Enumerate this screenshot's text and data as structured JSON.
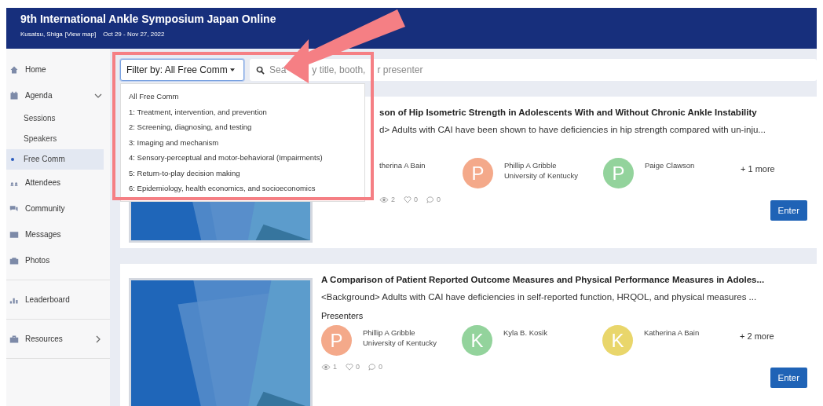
{
  "header": {
    "title": "9th International Ankle Symposium Japan Online",
    "location": "Kusatsu, Shiga",
    "map_link": "[View map]",
    "dates": "Oct 29 - Nov 27, 2022"
  },
  "sidebar": {
    "items": [
      {
        "label": "Home",
        "selected": false
      },
      {
        "label": "Agenda",
        "selected": false,
        "expanded": true,
        "children": [
          {
            "label": "Sessions",
            "selected": false
          },
          {
            "label": "Speakers",
            "selected": false
          },
          {
            "label": "Free Comm",
            "selected": true
          }
        ]
      },
      {
        "label": "Attendees",
        "selected": false
      },
      {
        "label": "Community",
        "selected": false
      },
      {
        "label": "Messages",
        "selected": false
      },
      {
        "label": "Photos",
        "selected": false
      },
      {
        "label": "Leaderboard",
        "selected": false
      },
      {
        "label": "Resources",
        "selected": false,
        "expanded": false
      }
    ]
  },
  "filter": {
    "label": "Filter by: All Free Comm",
    "open": true,
    "options": [
      "All Free Comm",
      "1: Treatment, intervention, and prevention",
      "2: Screening, diagnosing, and testing",
      "3: Imaging and mechanism",
      "4: Sensory-perceptual and motor-behavioral (Impairments)",
      "5: Return-to-play decision making",
      "6: Epidemiology, health economics, and socioeconomics"
    ]
  },
  "search": {
    "placeholder_parts": [
      "Sea",
      "y title, booth,",
      "r presenter"
    ]
  },
  "cards": [
    {
      "title": "son of Hip Isometric Strength in Adolescents With and Without Chronic Ankle Instability",
      "summary": "d> Adults with CAI have been shown to have deficiencies in hip strength compared with un-inju...",
      "presenters": [
        {
          "name": "therina A Bain"
        },
        {
          "initial": "P",
          "name": "Phillip A Gribble",
          "affiliation": "University of Kentucky",
          "color": "#f4a98a"
        },
        {
          "initial": "P",
          "name": "Paige Clawson",
          "color": "#93d39c"
        }
      ],
      "more": "+ 1 more",
      "views": "2",
      "likes": "0",
      "comments": "0",
      "button": "Enter"
    },
    {
      "title": "A Comparison of Patient Reported Outcome Measures and Physical Performance Measures in Adoles...",
      "summary": "<Background> Adults with CAI have deficiencies in self-reported function, HRQOL, and physical measures ...",
      "presenters_label": "Presenters",
      "presenters": [
        {
          "initial": "P",
          "name": "Phillip A Gribble",
          "affiliation": "University of Kentucky",
          "color": "#f4a98a"
        },
        {
          "initial": "K",
          "name": "Kyla B. Kosik",
          "color": "#93d39c"
        },
        {
          "initial": "K",
          "name": "Katherina A Bain",
          "color": "#e9d66b"
        }
      ],
      "more": "+ 2 more",
      "views": "1",
      "likes": "0",
      "comments": "0",
      "button": "Enter"
    }
  ],
  "annotation": {
    "kind": "arrow-and-box"
  }
}
